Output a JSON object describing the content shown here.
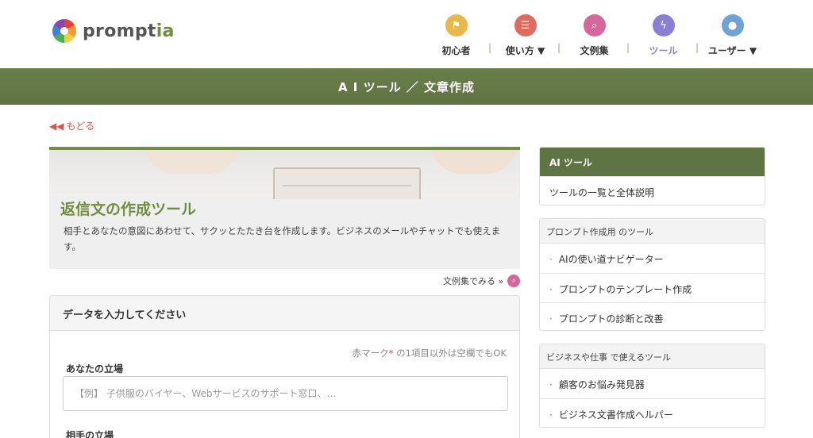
{
  "logo": {
    "prefix": "prompt",
    "suffix": "ia"
  },
  "nav": [
    {
      "label": "初心者",
      "icon": "flag-icon",
      "color": "#e8b84a",
      "glyph": "⚑"
    },
    {
      "label": "使い方 ▼",
      "icon": "list-icon",
      "color": "#e06a5f",
      "glyph": "☰"
    },
    {
      "label": "文例集",
      "icon": "search-icon",
      "color": "#d6679b",
      "glyph": "⌕"
    },
    {
      "label": "ツール",
      "icon": "lightning-icon",
      "color": "#8b7fd4",
      "glyph": "ϟ",
      "active": true
    },
    {
      "label": "ユーザー ▼",
      "icon": "user-icon",
      "color": "#6fa3d8",
      "glyph": "●"
    }
  ],
  "band": {
    "title": "A I ツール ／ 文章作成"
  },
  "back": {
    "label": "もどる",
    "icon": "double-chevron-left-icon"
  },
  "hero": {
    "title": "返信文の作成ツール",
    "description": "相手とあなたの意図にあわせて、サクッとたたき台を作成します。ビジネスのメールやチャットでも使えます。"
  },
  "examples_link": {
    "label": "文例集でみる »"
  },
  "form": {
    "heading": "データを入力してください",
    "required_note_prefix": "赤マーク",
    "required_note_star": "*",
    "required_note_suffix": " の1項目以外は空欄でもOK",
    "field1_label": "あなたの立場",
    "field1_placeholder": "【例】 子供服のバイヤー、Webサービスのサポート窓口、…",
    "field2_label": "相手の立場"
  },
  "sidebar": {
    "ai_tools": {
      "heading": "AI ツール",
      "items": [
        "ツールの一覧と全体説明"
      ]
    },
    "prompt_tools": {
      "heading": "プロンプト作成用 のツール",
      "items": [
        "AIの使い道ナビゲーター",
        "プロンプトのテンプレート作成",
        "プロンプトの診断と改善"
      ]
    },
    "business_tools": {
      "heading": "ビジネスや仕事 で使えるツール",
      "items": [
        "顧客のお悩み発見器",
        "ビジネス文書作成ヘルパー"
      ]
    }
  },
  "colors": {
    "accent_green": "#6f8f3f",
    "band_green": "#5f7443",
    "back_red": "#d9534f"
  }
}
